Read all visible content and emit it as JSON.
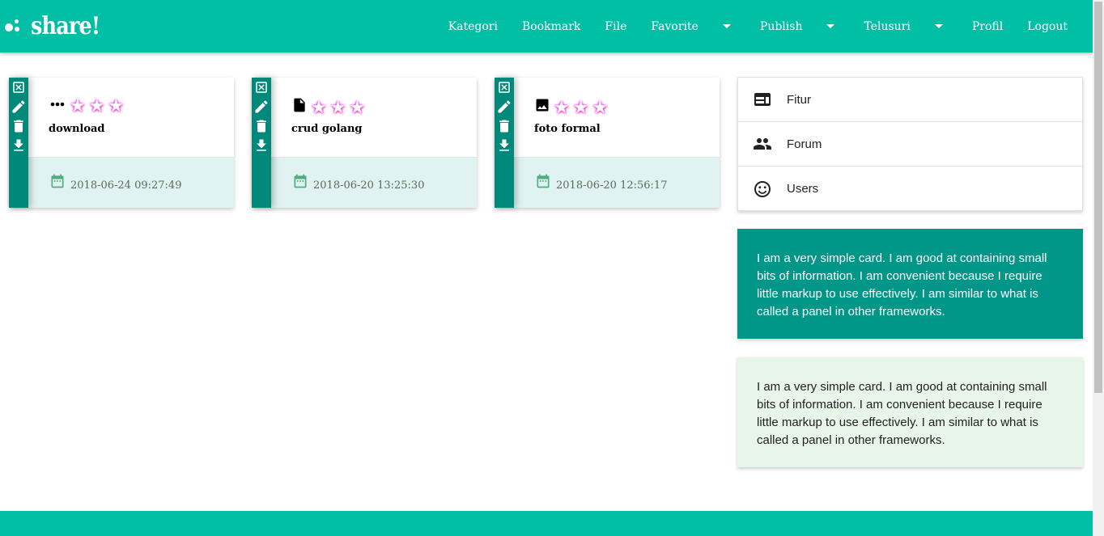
{
  "navbar": {
    "brand": "share!",
    "items": [
      {
        "label": "Kategori"
      },
      {
        "label": "Bookmark"
      },
      {
        "label": "File"
      },
      {
        "label": "Favorite"
      },
      {
        "label": "Publish"
      },
      {
        "label": "Telusuri"
      },
      {
        "label": "Profil"
      },
      {
        "label": "Logout"
      }
    ]
  },
  "cards": [
    {
      "title": "download",
      "type_icon": "more-horiz-icon",
      "rating": 3,
      "date": "2018-06-24 09:27:49"
    },
    {
      "title": "crud golang",
      "type_icon": "file-icon",
      "rating": 3,
      "date": "2018-06-20 13:25:30"
    },
    {
      "title": "foto formal",
      "type_icon": "image-icon",
      "rating": 3,
      "date": "2018-06-20 12:56:17"
    }
  ],
  "sidebar": {
    "items": [
      {
        "label": "Fitur",
        "icon": "web-icon"
      },
      {
        "label": "Forum",
        "icon": "people-icon"
      },
      {
        "label": "Users",
        "icon": "smiley-icon"
      }
    ],
    "panel_teal": "I am a very simple card. I am good at containing small bits of information. I am convenient because I require little markup to use effectively. I am similar to what is called a panel in other frameworks.",
    "panel_green": "I am a very simple card. I am good at containing small bits of information. I am convenient because I require little markup to use effectively. I am similar to what is called a panel in other frameworks."
  },
  "colors": {
    "navbar": "#00bfa5",
    "rail": "#00897b",
    "card_bottom": "#e0f2f1",
    "panel_teal": "#009688",
    "panel_green": "#e8f5e9"
  }
}
